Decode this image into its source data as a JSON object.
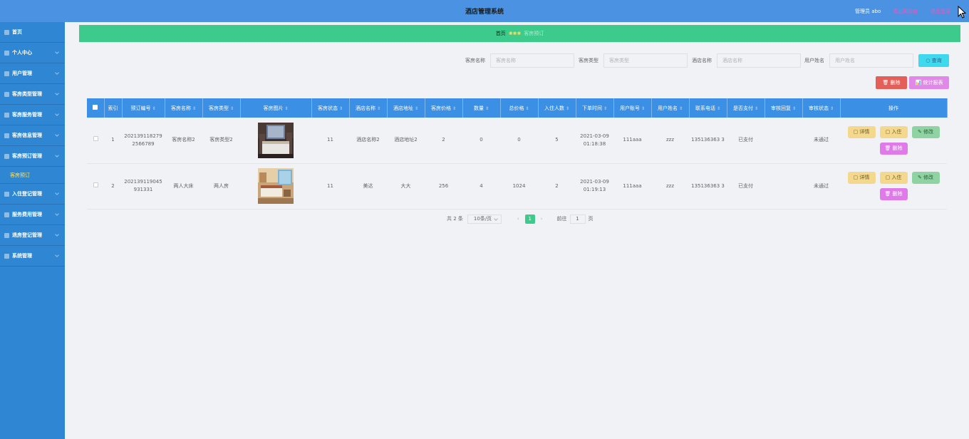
{
  "header": {
    "title": "酒店管理系统",
    "admin": "管理员 abo",
    "link1": "退出到前台",
    "link2": "退出登录"
  },
  "sidebar": {
    "items": [
      {
        "label": "首页",
        "icon": "home-icon"
      },
      {
        "label": "个人中心",
        "icon": "user-icon"
      },
      {
        "label": "用户管理",
        "icon": "users-icon"
      },
      {
        "label": "客房类型管理",
        "icon": "grid-icon"
      },
      {
        "label": "客房服务管理",
        "icon": "service-icon"
      },
      {
        "label": "客房信息管理",
        "icon": "info-icon"
      },
      {
        "label": "客房预订管理",
        "icon": "calendar-icon"
      }
    ],
    "sub_item": "客房预订",
    "items2": [
      {
        "label": "入住登记管理",
        "icon": "checkin-icon"
      },
      {
        "label": "服务费用管理",
        "icon": "fee-icon"
      },
      {
        "label": "退房登记管理",
        "icon": "checkout-icon"
      },
      {
        "label": "系统管理",
        "icon": "settings-icon"
      }
    ]
  },
  "breadcrumb": {
    "home": "首页",
    "sep": "❀❀❀",
    "current": "客房预订"
  },
  "search": {
    "fields": [
      {
        "label": "客房名称",
        "placeholder": "客房名称"
      },
      {
        "label": "客房类型",
        "placeholder": "客房类型"
      },
      {
        "label": "酒店名称",
        "placeholder": "酒店名称"
      },
      {
        "label": "用户姓名",
        "placeholder": "用户姓名"
      }
    ],
    "query_label": "○ 查询"
  },
  "actions": {
    "delete_label": "🗑 删除",
    "stats_label": "📊 统计报表"
  },
  "table": {
    "headers": [
      "索引",
      "预订编号",
      "客房名称",
      "客房类型",
      "客房图片",
      "客房状态",
      "酒店名称",
      "酒店地址",
      "客房价格",
      "数量",
      "总价格",
      "入住人数",
      "下单时间",
      "用户账号",
      "用户姓名",
      "联系电话",
      "是否支付",
      "审核回复",
      "审核状态",
      "操作"
    ],
    "rows": [
      {
        "index": "1",
        "order_no": "202139118279 2566789",
        "room_name": "客房名称2",
        "room_type": "客房类型2",
        "status": "11",
        "hotel_name": "酒店名称2",
        "hotel_addr": "酒店地址2",
        "price": "2",
        "qty": "0",
        "total": "0",
        "guests": "5",
        "time": "2021-03-09 01:18:38",
        "account": "111aaa",
        "user_name": "zzz",
        "phone": "135136363 3",
        "paid": "已支付",
        "reply": "",
        "audit": "未通过",
        "photo": "room-dark"
      },
      {
        "index": "2",
        "order_no": "202139119045 931331",
        "room_name": "两人大床",
        "room_type": "两人房",
        "status": "11",
        "hotel_name": "美达",
        "hotel_addr": "大大",
        "price": "256",
        "qty": "4",
        "total": "1024",
        "guests": "2",
        "time": "2021-03-09 01:19:13",
        "account": "111aaa",
        "user_name": "zzz",
        "phone": "135136363 3",
        "paid": "已支付",
        "reply": "",
        "audit": "未通过",
        "photo": "room-light"
      }
    ],
    "op_labels": {
      "detail": "▢ 详情",
      "checkin": "▢ 入住",
      "edit": "✎ 修改",
      "delete": "🗑 删除"
    }
  },
  "pagination": {
    "total": "共 2 条",
    "page_size": "10条/页",
    "prev": "‹",
    "current": "1",
    "next": "›",
    "goto_label": "前往",
    "goto_value": "1",
    "page_suffix": "页"
  },
  "colors": {
    "header": "#4b93e2",
    "sidebar": "#2f87d3",
    "breadcrumb": "#3dcb8c",
    "table_header": "#3b90e5"
  }
}
